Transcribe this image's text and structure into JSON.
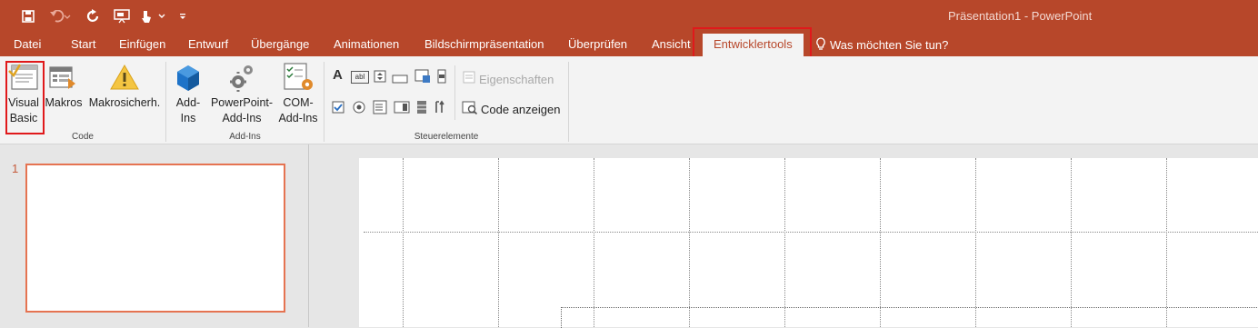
{
  "window": {
    "title": "Präsentation1 - PowerPoint"
  },
  "colors": {
    "accent": "#b7472a",
    "highlight_box": "#e0191b",
    "slide_border": "#e57351"
  },
  "quick_access": [
    {
      "name": "save-icon"
    },
    {
      "name": "undo-icon"
    },
    {
      "name": "redo-icon"
    },
    {
      "name": "start-from-beginning-icon"
    },
    {
      "name": "touch-mode-icon"
    },
    {
      "name": "customize-qat-icon"
    }
  ],
  "tabs": [
    {
      "label": "Datei"
    },
    {
      "label": "Start"
    },
    {
      "label": "Einfügen"
    },
    {
      "label": "Entwurf"
    },
    {
      "label": "Übergänge"
    },
    {
      "label": "Animationen"
    },
    {
      "label": "Bildschirmpräsentation"
    },
    {
      "label": "Überprüfen"
    },
    {
      "label": "Ansicht"
    },
    {
      "label": "Entwicklertools",
      "active": true
    }
  ],
  "tell_me": {
    "label": "Was möchten Sie tun?"
  },
  "ribbon": {
    "groups": [
      {
        "label": "Code",
        "buttons": [
          {
            "label_line1": "Visual",
            "label_line2": "Basic",
            "icon": "visual-basic-icon"
          },
          {
            "label_line1": "Makros",
            "icon": "macros-icon"
          },
          {
            "label_line1": "Makrosicherh.",
            "icon": "macro-security-icon"
          }
        ]
      },
      {
        "label": "Add-Ins",
        "buttons": [
          {
            "label_line1": "Add-",
            "label_line2": "Ins",
            "icon": "add-ins-icon"
          },
          {
            "label_line1": "PowerPoint-",
            "label_line2": "Add-Ins",
            "icon": "powerpoint-add-ins-icon"
          },
          {
            "label_line1": "COM-",
            "label_line2": "Add-Ins",
            "icon": "com-add-ins-icon"
          }
        ]
      },
      {
        "label": "Steuerelemente",
        "properties_label": "Eigenschaften",
        "view_code_label": "Code anzeigen",
        "label_control_glyph": "A",
        "textbox_control_glyph": "abl"
      }
    ]
  },
  "slides_pane": {
    "slides": [
      {
        "number": "1"
      }
    ]
  }
}
